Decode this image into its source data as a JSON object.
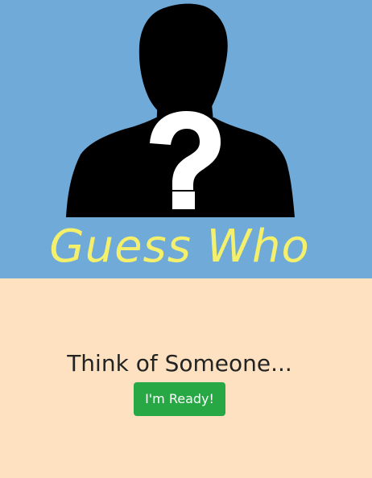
{
  "header": {
    "background_color": "#6faad9",
    "logo": {
      "icon": "person-question-mark-icon",
      "title": "Guess Who",
      "title_color": "#f4f06c"
    }
  },
  "main": {
    "background_color": "#fde1c1",
    "prompt": "Think of Someone...",
    "ready_button": {
      "label": "I'm Ready!",
      "color": "#28a745"
    }
  }
}
